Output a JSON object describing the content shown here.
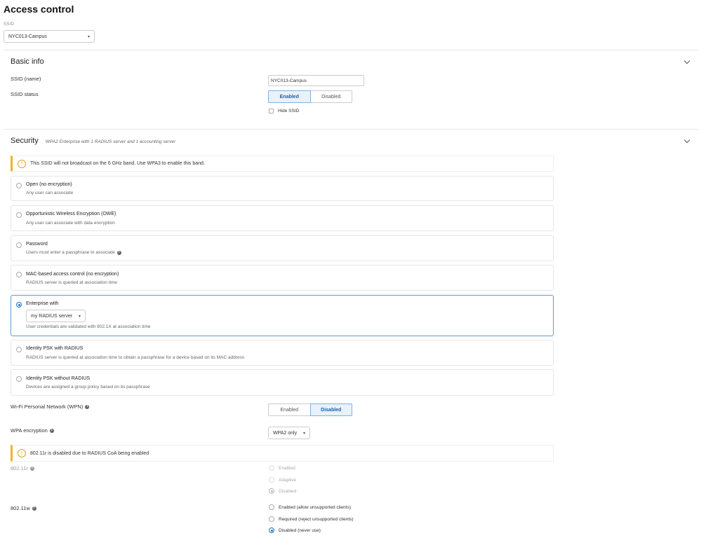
{
  "page": {
    "title": "Access control"
  },
  "ssid_selector": {
    "label": "SSID",
    "value": "NYC013-Campus"
  },
  "basic_info": {
    "title": "Basic info",
    "ssid_name_label": "SSID (name)",
    "ssid_name_value": "NYC013-Campus",
    "ssid_status_label": "SSID status",
    "status_options": [
      "Enabled",
      "Disabled"
    ],
    "status_selected": "Enabled",
    "hide_ssid_label": "Hide SSID",
    "hide_ssid_checked": false
  },
  "security": {
    "title": "Security",
    "subtitle": "WPA2 Enterprise with 1 RADIUS server and 1 accounting server",
    "alert_6ghz": "This SSID will not broadcast on the 6 GHz band. Use WPA3 to enable this band.",
    "options": [
      {
        "title": "Open (no encryption)",
        "desc": "Any user can associate"
      },
      {
        "title": "Opportunistic Wireless Encryption (OWE)",
        "desc": "Any user can associate with data encryption"
      },
      {
        "title": "Password",
        "desc": "Users must enter a passphrase to associate"
      },
      {
        "title": "MAC-based access control (no encryption)",
        "desc": "RADIUS server is queried at association time"
      },
      {
        "title": "Enterprise with",
        "dropdown": "my RADIUS server",
        "desc": "User credentials are validated with 802.1X at association time"
      },
      {
        "title": "Identity PSK with RADIUS",
        "desc": "RADIUS server is queried at association time to obtain a passphrase for a device based on its MAC address"
      },
      {
        "title": "Identity PSK without RADIUS",
        "desc": "Devices are assigned a group policy based on its passphrase"
      }
    ],
    "selected_option": "Enterprise with",
    "wpn": {
      "label": "Wi-Fi Personal Network (WPN)",
      "options": [
        "Enabled",
        "Disabled"
      ],
      "selected": "Disabled"
    },
    "wpa_encryption": {
      "label": "WPA encryption",
      "value": "WPA2 only"
    },
    "alert_80211r": "802.11r is disabled due to RADIUS CoA being enabled",
    "dot11r": {
      "label": "802.11r",
      "options": [
        "Enabled",
        "Adaptive",
        "Disabled"
      ],
      "selected": "Disabled",
      "disabled": true
    },
    "dot11w": {
      "label": "802.11w",
      "options": [
        "Enabled (allow unsupported clients)",
        "Required (reject unsupported clients)",
        "Disabled (never use)"
      ],
      "selected": "Disabled (never use)"
    }
  },
  "colors": {
    "accent": "#1a6fc4",
    "warning": "#f0b429",
    "selected_bg": "#e8f2fb"
  }
}
